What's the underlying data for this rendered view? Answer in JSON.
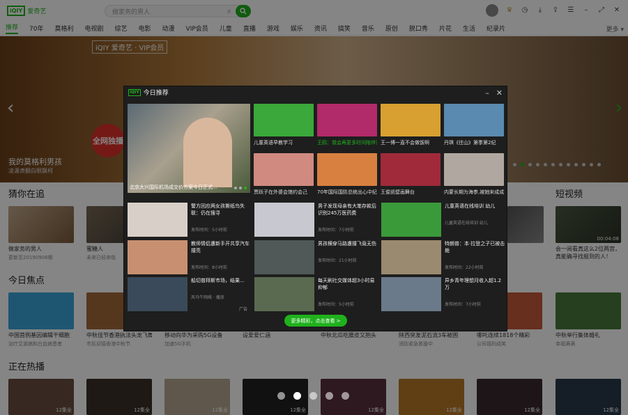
{
  "app": {
    "logo_mark": "iQIY",
    "logo_text": "爱奇艺"
  },
  "search": {
    "placeholder": "做家务的男人"
  },
  "nav": {
    "items": [
      "推荐",
      "70年",
      "莫格利",
      "电视剧",
      "综艺",
      "电影",
      "动漫",
      "VIP会员",
      "儿童",
      "直播",
      "游戏",
      "娱乐",
      "资讯",
      "搞笑",
      "音乐",
      "原创",
      "脱口秀",
      "片花",
      "生活",
      "纪录片"
    ],
    "active_index": 0,
    "more": "更多 ▾"
  },
  "banner": {
    "logo": "iQIY 爱奇艺 · VIP会员",
    "title": "我的莫格利男孩",
    "subtitle": "凌潇肃翻白眼飘柯",
    "badge": "全网独播",
    "dots": 12,
    "active_dot": 1
  },
  "sections": {
    "guess": "猜你在追",
    "focus": "今日焦点",
    "hot": "正在热播",
    "short": "短视频"
  },
  "guess_cards": [
    {
      "title": "做家务的男人",
      "sub": "更新至20190906期"
    },
    {
      "title": "蜜糖人",
      "sub": "未来已经来临"
    }
  ],
  "short_card": {
    "title": "会一阅看真这么2位两宫，真能确寻找报到的人！",
    "duration": "00:04:08"
  },
  "focus_cards": [
    {
      "title": "中国首例基因编辑干细胞",
      "sub": "治疗艾滋病和白血病患者"
    },
    {
      "title": "中秋佳节香港执法头龙飞舞",
      "sub": "市民迎接香港中秋节"
    },
    {
      "title": "移动向华为采购5G设备",
      "sub": "加速5G手机"
    },
    {
      "title": "设爱爱仁涵",
      "sub": ""
    },
    {
      "title": "中秋北瓜吃腰皮又抱头",
      "sub": ""
    },
    {
      "title": "陕西突发泥石流3车被困",
      "sub": "消防紧急救援中"
    },
    {
      "title": "哪吒连续1818个精彩",
      "sub": "公司福利成笑"
    },
    {
      "title": "中秋举行集体婚礼",
      "sub": "幸福满满"
    }
  ],
  "hot_badges": [
    "12集全",
    "12集全",
    "12集全",
    "12集全",
    "12集全",
    "12集全",
    "12集全",
    "12集全"
  ],
  "popup": {
    "title": "今日推荐",
    "big": {
      "caption": "北京大兴国际机场成交价方案今日正式..."
    },
    "top_tiles": [
      {
        "caption": "儿童英语早教学习",
        "green": false
      },
      {
        "caption": "王鸥：我会再更多时间陪伴家人",
        "green": true
      },
      {
        "caption": "王一博一直不会做饭啊",
        "green": false
      },
      {
        "caption": "丹琪《往山》第季第2纪",
        "green": false
      }
    ],
    "second_tiles": [
      {
        "caption": "贾跃子在外婆会馆约会己",
        "green": false
      },
      {
        "caption": "70年国际国防总统出心中纪典",
        "green": false
      },
      {
        "caption": "王俊凯壁画舞台",
        "green": false
      },
      {
        "caption": "内蒙长期为海参,被她宋成成",
        "green": false
      }
    ],
    "list_items": [
      {
        "title": "警方回应两女孩撕纸鸟失联：仍在搜寻",
        "meta": "发布时间：5小时前"
      },
      {
        "title": "男子发现母亲有大笔存款后识别245万医药费",
        "meta": "发布时间：7小时前"
      },
      {
        "title": "儿童英语在线培训 幼儿",
        "meta": "儿童英语在线培训 幼儿"
      },
      {
        "title": "教师情侣遭新手开共享汽车撞亮",
        "meta": "发布时间：8小时前"
      },
      {
        "title": "男孩横穿马路遭撞飞竟无伤",
        "meta": "发布时间：21小时前"
      },
      {
        "title": "特朗普：本·拉登之子已被击毙",
        "meta": "发布时间：22小时前"
      },
      {
        "title": "船切普拜斯市场，结果...",
        "meta": "风马牛网络 · 播放"
      },
      {
        "title": "每天刷社交媒体超3小时易抑郁",
        "meta": "发布时间：5小时前"
      },
      {
        "title": "异乡青年理想月收入超1.2万",
        "meta": "发布时间：7小时前"
      }
    ],
    "ad_label": "广告",
    "more_label": "更多精彩，点击查看 >"
  },
  "colors": {
    "accent": "#20b11d"
  }
}
